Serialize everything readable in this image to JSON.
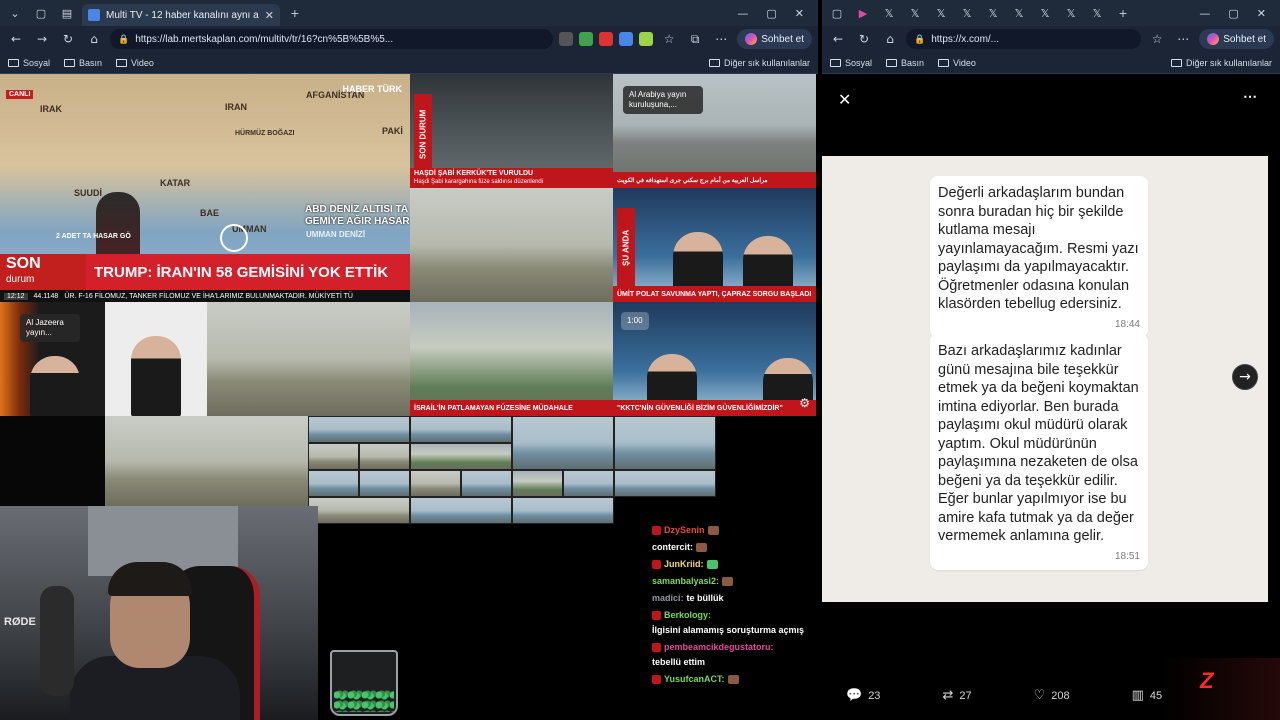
{
  "left_window": {
    "tab_title": "Multi TV - 12 haber kanalını aynı a",
    "url": "https://lab.mertskaplan.com/multitv/tr/16?cn%5B%5B%5...",
    "chat_button": "Sohbet et",
    "bookmarks": [
      "Sosyal",
      "Basın",
      "Video"
    ],
    "bookmarks_other": "Diğer sık kullanılanlar"
  },
  "right_window": {
    "url": "https://x.com/...",
    "chat_button": "Sohbet et",
    "bookmarks": [
      "Sosyal",
      "Basın",
      "Video"
    ],
    "bookmarks_other": "Diğer sık kullanılanlar"
  },
  "tiles": {
    "main": {
      "canli": "CANLI",
      "map_labels": [
        "IRAK",
        "IRAN",
        "AFGANİSTAN",
        "PAKİ",
        "HÜRMÜZ BOĞAZI",
        "KATAR",
        "BAE",
        "UMMAN",
        "SUUDİ",
        "UMMAN DENİZİ"
      ],
      "logo": "HABER TÜRK",
      "left_note": "2 ADET TA HASAR GÖ",
      "right_note": "ABD DENİZ ALTISI TA GEMİYE AĞIR HASAR",
      "son": "SON",
      "durum": "durum",
      "headline": "TRUMP: İRAN'IN 58 GEMİSİNİ YOK ETTİK",
      "time": "12:12",
      "index": "44.1148",
      "ticker": "ÜR. F-16 FİLOMUZ, TANKER FİLOMUZ VE İHA'LARIMIZ BULUNMAKTADIR. MÜKİYETİ TÜ"
    },
    "t2": {
      "vbadge": "SON DURUM",
      "bar1": "HAŞDİ ŞABİ KERKÜK'TE VURULDU",
      "bar2": "Haşdi Şabi karargahına füze saldırısı düzenlendi"
    },
    "t3": {
      "overlay": "Al Arabiya yayın kuruluşuna,...",
      "bar": "مراسل العربية من أمام برج سكني جرى استهدافه في الكويت"
    },
    "t5": {
      "vbadge": "ŞU ANDA",
      "bar": "ÜMİT POLAT SAVUNMA YAPTI, ÇAPRAZ SORGU BAŞLADI"
    },
    "t6": {
      "overlay": "Al Jazeera yayın..."
    },
    "t7": {
      "bar": "İSRAİL'İN PATLAMAYAN FÜZESİNE MÜDAHALE"
    },
    "t8": {
      "time": "1:00",
      "bar": "\"KKTC'NİN GÜVENLİĞİ BİZİM GÜVENLİĞİMİZDİR\""
    }
  },
  "webcam": {
    "brand": "RØDE"
  },
  "chat": [
    {
      "user": "DzySenin",
      "text": "",
      "color": "red"
    },
    {
      "user": "contercit:",
      "text": "",
      "color": "white"
    },
    {
      "user": "JunKriid:",
      "text": "",
      "color": "yel"
    },
    {
      "user": "samanbalyasi2:",
      "text": "",
      "color": "green"
    },
    {
      "user": "madici:",
      "text": "te büllük",
      "color": "mute"
    },
    {
      "user": "Berkology:",
      "text": "İlgisini alamamış soruşturma açmış",
      "color": "green"
    },
    {
      "user": "pembeamcikdegustatoru:",
      "text": "tebellü ettim",
      "color": "pink"
    },
    {
      "user": "YusufcanACT:",
      "text": "",
      "color": "green"
    }
  ],
  "post": {
    "bubble1": {
      "text": "Değerli arkadaşlarım bundan sonra buradan hiç bir şekilde kutlama mesajı yayınlamayacağım. Resmi yazı paylaşımı da yapılmayacaktır. Öğretmenler odasına konulan klasörden tebellug edersiniz.",
      "time": "18:44"
    },
    "bubble2": {
      "text": "Bazı arkadaşlarımız kadınlar günü mesajına bile teşekkür etmek ya da beğeni koymaktan imtina ediyorlar. Ben burada paylaşımı okul müdürü olarak yaptım. Okul müdürünün paylaşımına nezaketen de olsa beğeni ya da teşekkür edilir. Eğer bunlar yapılmıyor ise bu amire kafa tutmak ya da değer vermemek anlamına gelir.",
      "time": "18:51"
    },
    "replies": "23",
    "reposts": "27",
    "likes": "208",
    "views": "45"
  }
}
